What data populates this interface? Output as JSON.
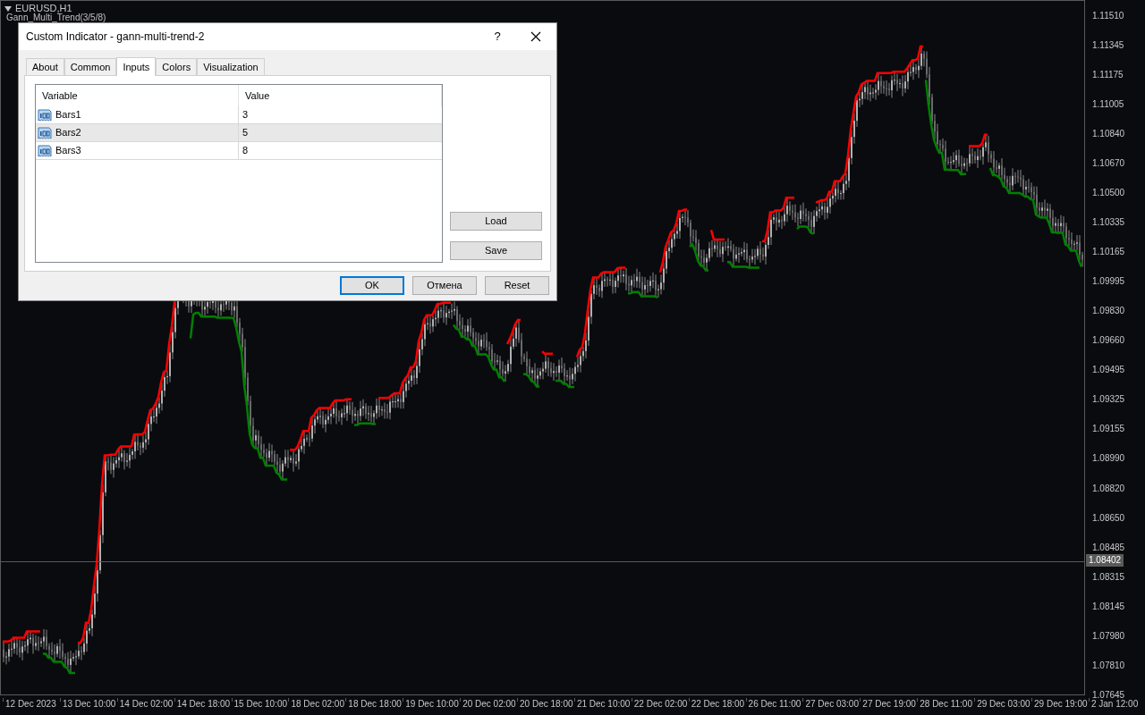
{
  "chart": {
    "legend": {
      "symbol": "EURUSD,H1",
      "indicator": "Gann_Multi_Trend(3/5/8)"
    },
    "price_labels": [
      "1.11510",
      "1.11345",
      "1.11175",
      "1.11005",
      "1.10840",
      "1.10670",
      "1.10500",
      "1.10335",
      "1.10165",
      "1.09995",
      "1.09830",
      "1.09660",
      "1.09495",
      "1.09325",
      "1.09155",
      "1.08990",
      "1.08820",
      "1.08650",
      "1.08485",
      "1.08315",
      "1.08145",
      "1.07980",
      "1.07810",
      "1.07645"
    ],
    "current_price": "1.08402",
    "time_labels": [
      "12 Dec 2023",
      "13 Dec 10:00",
      "14 Dec 02:00",
      "14 Dec 18:00",
      "15 Dec 10:00",
      "18 Dec 02:00",
      "18 Dec 18:00",
      "19 Dec 10:00",
      "20 Dec 02:00",
      "20 Dec 18:00",
      "21 Dec 10:00",
      "22 Dec 02:00",
      "22 Dec 18:00",
      "26 Dec 11:00",
      "27 Dec 03:00",
      "27 Dec 19:00",
      "28 Dec 11:00",
      "29 Dec 03:00",
      "29 Dec 19:00",
      "2 Jan 12:00"
    ]
  },
  "dialog": {
    "title": "Custom Indicator - gann-multi-trend-2",
    "help": "?",
    "tabs": [
      {
        "label": "About",
        "selected": false
      },
      {
        "label": "Common",
        "selected": false
      },
      {
        "label": "Inputs",
        "selected": true
      },
      {
        "label": "Colors",
        "selected": false
      },
      {
        "label": "Visualization",
        "selected": false
      }
    ],
    "table": {
      "columns": [
        "Variable",
        "Value"
      ],
      "rows": [
        {
          "variable": "Bars1",
          "value": "3",
          "selected": false
        },
        {
          "variable": "Bars2",
          "value": "5",
          "selected": true
        },
        {
          "variable": "Bars3",
          "value": "8",
          "selected": false
        }
      ]
    },
    "side_buttons": [
      "Load",
      "Save"
    ],
    "buttons": [
      {
        "label": "OK",
        "default": true
      },
      {
        "label": "Отмена",
        "default": false
      },
      {
        "label": "Reset",
        "default": false
      }
    ]
  }
}
